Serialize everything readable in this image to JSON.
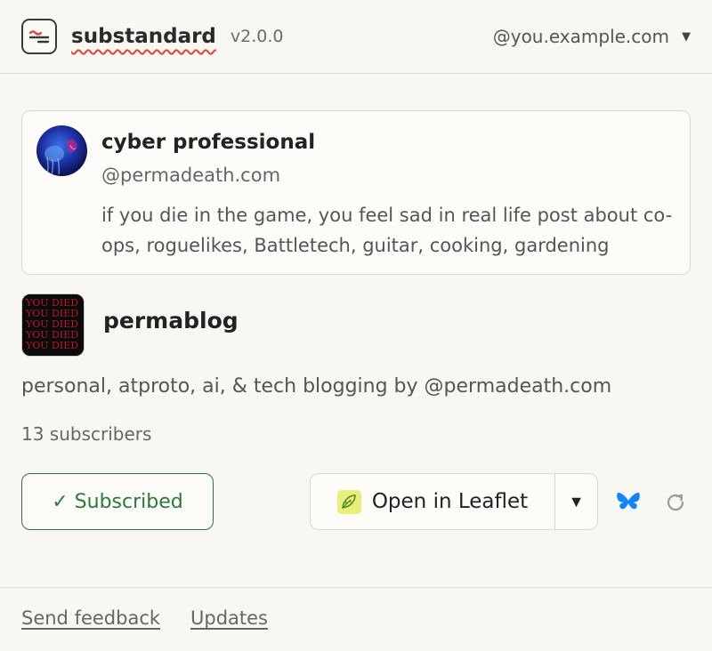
{
  "header": {
    "app_name": "substandard",
    "version": "v2.0.0",
    "account": "@you.example.com",
    "logo_icon": "chat-lines-icon",
    "caret_icon": "triangle-down-icon"
  },
  "profile": {
    "name": "cyber professional",
    "handle": "@permadeath.com",
    "bio": "if you die in the game, you feel sad in real life post about co-ops, roguelikes, Battletech, guitar, cooking, gardening",
    "avatar_icon": "jellyfish-avatar"
  },
  "publication": {
    "icon_lines": [
      "YOU DIED",
      "YOU DIED",
      "YOU DIED",
      "YOU DIED",
      "YOU DIED"
    ],
    "name": "permablog",
    "description": "personal, atproto, ai, & tech blogging by @permadeath.com",
    "subscribers": "13 subscribers"
  },
  "actions": {
    "subscribed_label": "✓ Subscribed",
    "open_label": "Open in Leaflet",
    "open_menu_label": "▼",
    "leaflet_icon": "leaf-icon",
    "bluesky_icon": "butterfly-icon",
    "refresh_icon": "refresh-icon"
  },
  "footer": {
    "feedback": "Send feedback",
    "updates": "Updates"
  },
  "colors": {
    "background": "#f9f7f2",
    "accent_green": "#2b7a3d",
    "brand_red": "#d9473a",
    "bluesky_blue": "#1185fe",
    "leaflet_yellow": "#e7ef7a"
  }
}
